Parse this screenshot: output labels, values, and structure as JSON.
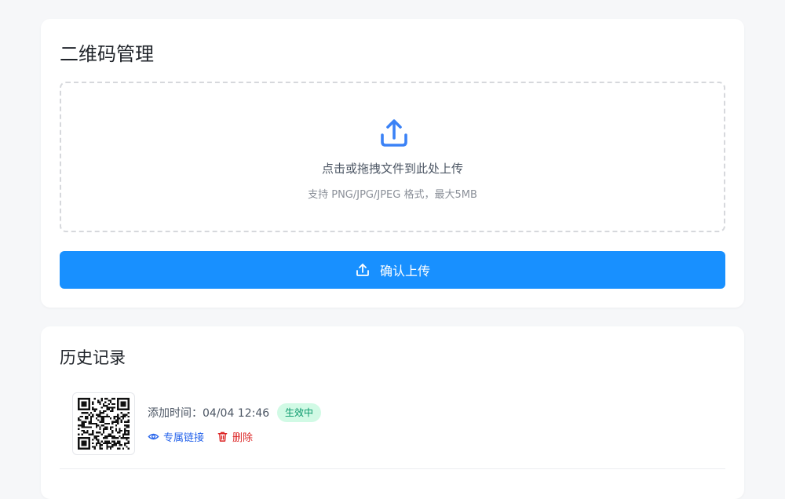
{
  "upload_card": {
    "title": "二维码管理",
    "drop_text": "点击或拖拽文件到此处上传",
    "drop_hint": "支持 PNG/JPG/JPEG 格式，最大5MB",
    "confirm_label": "确认上传"
  },
  "history_card": {
    "title": "历史记录",
    "records": [
      {
        "time_label": "添加时间：",
        "time_value": "04/04 12:46",
        "status": "生效中",
        "link_label": "专属链接",
        "delete_label": "删除"
      }
    ]
  },
  "colors": {
    "primary": "#1890ff",
    "status_bg": "#d1fae5",
    "status_text": "#059669",
    "link": "#2563eb",
    "danger": "#dc2626"
  },
  "icons": {
    "upload": "upload-icon",
    "button_upload": "upload-icon",
    "link": "eye-icon",
    "delete": "trash-icon",
    "qr": "qr-code-icon"
  }
}
